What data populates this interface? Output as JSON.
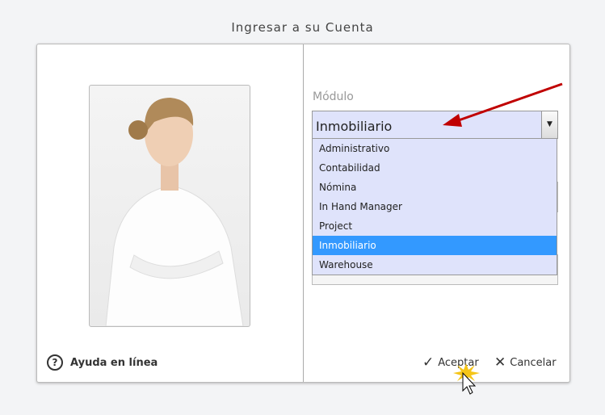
{
  "window": {
    "title": "Ingresar a su Cuenta"
  },
  "help": {
    "label": "Ayuda en línea"
  },
  "module": {
    "label": "Módulo",
    "selected": "Inmobiliario",
    "options": [
      "Administrativo",
      "Contabilidad",
      "Nómina",
      "In Hand Manager",
      "Project",
      "Inmobiliario",
      "Warehouse"
    ],
    "selected_index": 5
  },
  "buttons": {
    "accept": "Aceptar",
    "cancel": "Cancelar"
  },
  "colors": {
    "highlight": "#3399ff",
    "dropdown_bg": "#dfe3fb",
    "arrow": "#c00000"
  }
}
